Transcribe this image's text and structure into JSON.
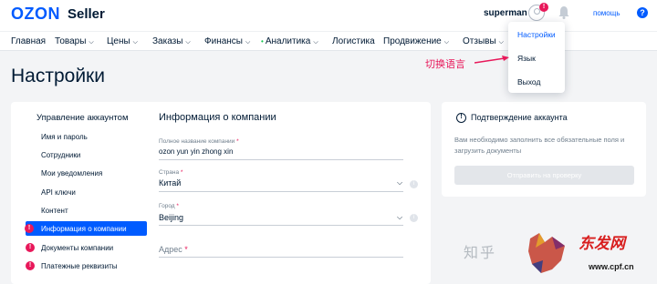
{
  "header": {
    "logo": "OZON",
    "logo_suffix": "Seller",
    "username": "superman",
    "avatar_badge": "!",
    "help_label": "помощь",
    "help_icon": "?"
  },
  "nav": {
    "items": [
      {
        "label": "Главная",
        "has_chevron": false
      },
      {
        "label": "Товары",
        "has_chevron": true
      },
      {
        "label": "Цены",
        "has_chevron": true
      },
      {
        "label": "Заказы",
        "has_chevron": true
      },
      {
        "label": "Финансы",
        "has_chevron": true
      },
      {
        "label": "Аналитика",
        "has_chevron": true,
        "dot": true
      },
      {
        "label": "Логистика",
        "has_chevron": false
      },
      {
        "label": "Продвижение",
        "has_chevron": true
      },
      {
        "label": "Отзывы",
        "has_chevron": true
      }
    ]
  },
  "dropdown": {
    "items": [
      "Настройки",
      "Язык",
      "Выход"
    ]
  },
  "annotation": {
    "text": "切换语言",
    "color": "#e8185a"
  },
  "page": {
    "title": "Настройки"
  },
  "sidebar": {
    "title": "Управление аккаунтом",
    "items": [
      {
        "label": "Имя и пароль",
        "alert": false
      },
      {
        "label": "Сотрудники",
        "alert": false
      },
      {
        "label": "Мои уведомления",
        "alert": false
      },
      {
        "label": "API ключи",
        "alert": false
      },
      {
        "label": "Контент",
        "alert": false
      },
      {
        "label": "Информация о компании",
        "alert": true,
        "active": true
      },
      {
        "label": "Документы компании",
        "alert": true
      },
      {
        "label": "Платежные реквизиты",
        "alert": true
      }
    ]
  },
  "company_form": {
    "title": "Информация о компании",
    "fields": {
      "name": {
        "label": "Полное название компании",
        "value": "ozon yun yin zhong xin"
      },
      "country": {
        "label": "Страна",
        "value": "Китай"
      },
      "city": {
        "label": "Город",
        "value": "Beijing"
      },
      "address": {
        "placeholder": "Адрес"
      }
    },
    "required_mark": "*"
  },
  "verification": {
    "title": "Подтверждение аккаунта",
    "icon": "!",
    "text": "Вам необходимо заполнить все обязательные поля и загрузить документы",
    "button_label": "Отправить на проверку"
  },
  "watermark": {
    "text": "知乎",
    "site_name": "东发网",
    "url": "www.cpf.cn"
  },
  "colors": {
    "brand": "#005bff",
    "alert": "#e8185a",
    "text": "#001a34",
    "muted": "#707f8d",
    "background": "#f3f4f6"
  }
}
